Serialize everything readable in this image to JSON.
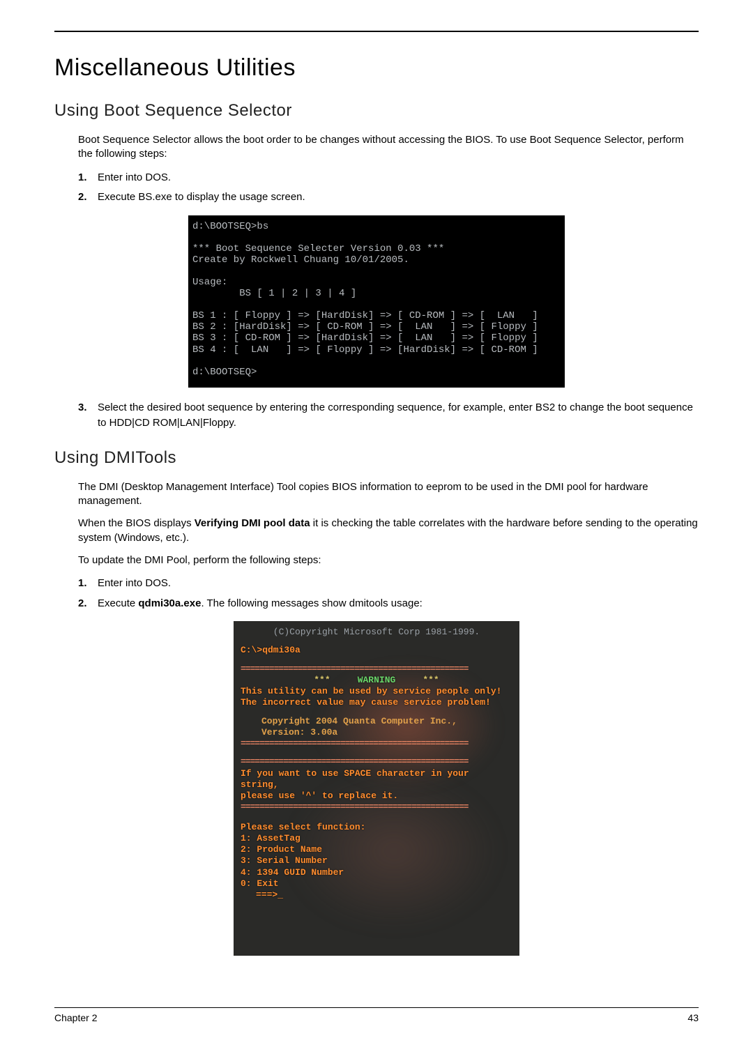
{
  "h1": "Miscellaneous Utilities",
  "section1": {
    "title": "Using Boot Sequence Selector",
    "intro": "Boot Sequence Selector allows the boot order to be changes without accessing the BIOS. To use Boot Sequence Selector, perform the following steps:",
    "steps": [
      {
        "n": "1.",
        "text": "Enter into DOS."
      },
      {
        "n": "2.",
        "text": "Execute BS.exe to display the usage screen."
      }
    ],
    "terminal": "d:\\BOOTSEQ>bs\n\n*** Boot Sequence Selecter Version 0.03 ***\nCreate by Rockwell Chuang 10/01/2005.\n\nUsage:\n        BS [ 1 | 2 | 3 | 4 ]\n\nBS 1 : [ Floppy ] => [HardDisk] => [ CD-ROM ] => [  LAN   ]\nBS 2 : [HardDisk] => [ CD-ROM ] => [  LAN   ] => [ Floppy ]\nBS 3 : [ CD-ROM ] => [HardDisk] => [  LAN   ] => [ Floppy ]\nBS 4 : [  LAN   ] => [ Floppy ] => [HardDisk] => [ CD-ROM ]\n\nd:\\BOOTSEQ>",
    "step3": {
      "n": "3.",
      "text": "Select the desired boot sequence by entering the corresponding sequence, for example, enter BS2 to change the boot sequence to HDD|CD ROM|LAN|Floppy."
    }
  },
  "section2": {
    "title": "Using DMITools",
    "p1": "The DMI (Desktop Management Interface) Tool copies BIOS information to eeprom to be used in the DMI pool for hardware management.",
    "p2a": "When the BIOS displays ",
    "p2b": "Verifying DMI pool data",
    "p2c": " it is checking the table correlates with the hardware before sending to the operating system (Windows, etc.).",
    "p3": "To update the DMI Pool, perform the following steps:",
    "steps": [
      {
        "n": "1.",
        "text": "Enter into DOS."
      },
      {
        "n": "2.",
        "pre": "Execute ",
        "bold": "qdmi30a.exe",
        "post": ". The following messages show dmitools usage:"
      }
    ],
    "shot": {
      "l1": "(C)Copyright Microsoft Corp 1981-1999.",
      "l2": "C:\\>qdmi30a",
      "hr": "================================================",
      "warn1a": "***",
      "warn1b": "WARNING",
      "warn1c": "***",
      "warn2": "This utility can be used by service people only!",
      "warn3": "The incorrect value may cause service problem!",
      "copy": "Copyright 2004 Quanta Computer Inc.,",
      "ver": "Version: 3.00a",
      "sp1": "If you want to use SPACE character in your string,",
      "sp2": "please use '^' to replace it.",
      "menuTitle": "Please select function:",
      "m1": "1: AssetTag",
      "m2": "2: Product Name",
      "m3": "3: Serial Number",
      "m4": "4: 1394 GUID Number",
      "m0": "0: Exit",
      "prompt": "===>_"
    }
  },
  "footer": {
    "left": "Chapter 2",
    "right": "43"
  }
}
